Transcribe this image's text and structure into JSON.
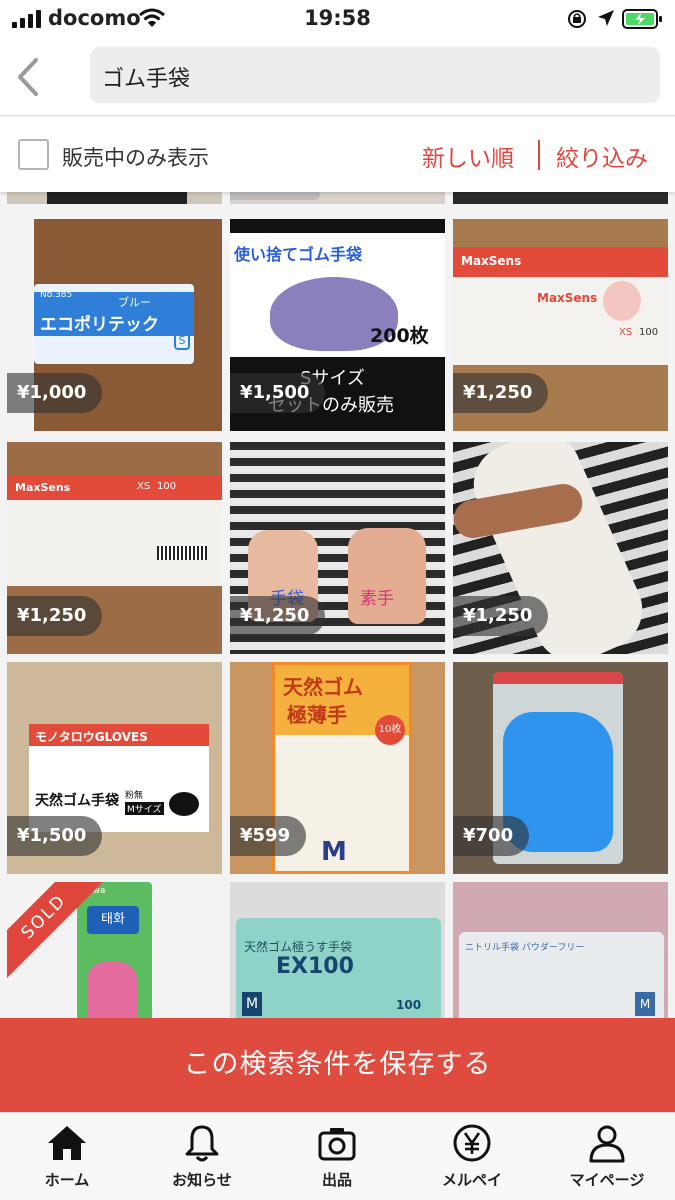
{
  "status_bar": {
    "carrier": "docomo",
    "time": "19:58"
  },
  "header": {
    "search_value": "ゴム手袋"
  },
  "filter": {
    "on_sale_only_label": "販売中のみ表示",
    "sort_label": "新しい順",
    "refine_label": "絞り込み"
  },
  "items": [
    {
      "price": "¥1,000",
      "thumb_text": [
        "No.385",
        "エコポリテック",
        "ブルー",
        "S"
      ],
      "sold": false
    },
    {
      "price": "¥1,500",
      "thumb_text": [
        "使い捨てゴム手袋",
        "200枚",
        "Sサイズ",
        "セットのみ販売"
      ],
      "sold": false
    },
    {
      "price": "¥1,250",
      "thumb_text": [
        "MaxSens",
        "MaxSens",
        "XS",
        "100"
      ],
      "sold": false
    },
    {
      "price": "¥1,250",
      "thumb_text": [
        "MaxSens",
        "XS",
        "100"
      ],
      "sold": false
    },
    {
      "price": "¥1,250",
      "thumb_text": [
        "手袋",
        "素手"
      ],
      "sold": false
    },
    {
      "price": "¥1,250",
      "thumb_text": [],
      "sold": false
    },
    {
      "price": "¥1,500",
      "thumb_text": [
        "モノタロウGLOVES",
        "天然ゴム手袋",
        "粉無",
        "Mサイズ"
      ],
      "sold": false
    },
    {
      "price": "¥599",
      "thumb_text": [
        "天然ゴム",
        "極薄手",
        "10枚",
        "M"
      ],
      "sold": false
    },
    {
      "price": "¥700",
      "thumb_text": [],
      "sold": false
    },
    {
      "price": "",
      "thumb_text": [
        "Towa",
        "태화"
      ],
      "sold": true,
      "sold_label": "SOLD"
    },
    {
      "price": "",
      "thumb_text": [
        "天然ゴム極うす手袋",
        "EX100",
        "M",
        "100"
      ],
      "sold": false
    },
    {
      "price": "",
      "thumb_text": [
        "ニトリル手袋 パウダーフリー",
        "M"
      ],
      "sold": false
    }
  ],
  "save_search_label": "この検索条件を保存する",
  "tabs": [
    {
      "label": "ホーム",
      "icon": "home-icon"
    },
    {
      "label": "お知らせ",
      "icon": "bell-icon"
    },
    {
      "label": "出品",
      "icon": "camera-icon"
    },
    {
      "label": "メルペイ",
      "icon": "yen-icon"
    },
    {
      "label": "マイページ",
      "icon": "person-icon"
    }
  ],
  "colors": {
    "accent": "#e0473c",
    "save_bar": "#df4b3e"
  }
}
